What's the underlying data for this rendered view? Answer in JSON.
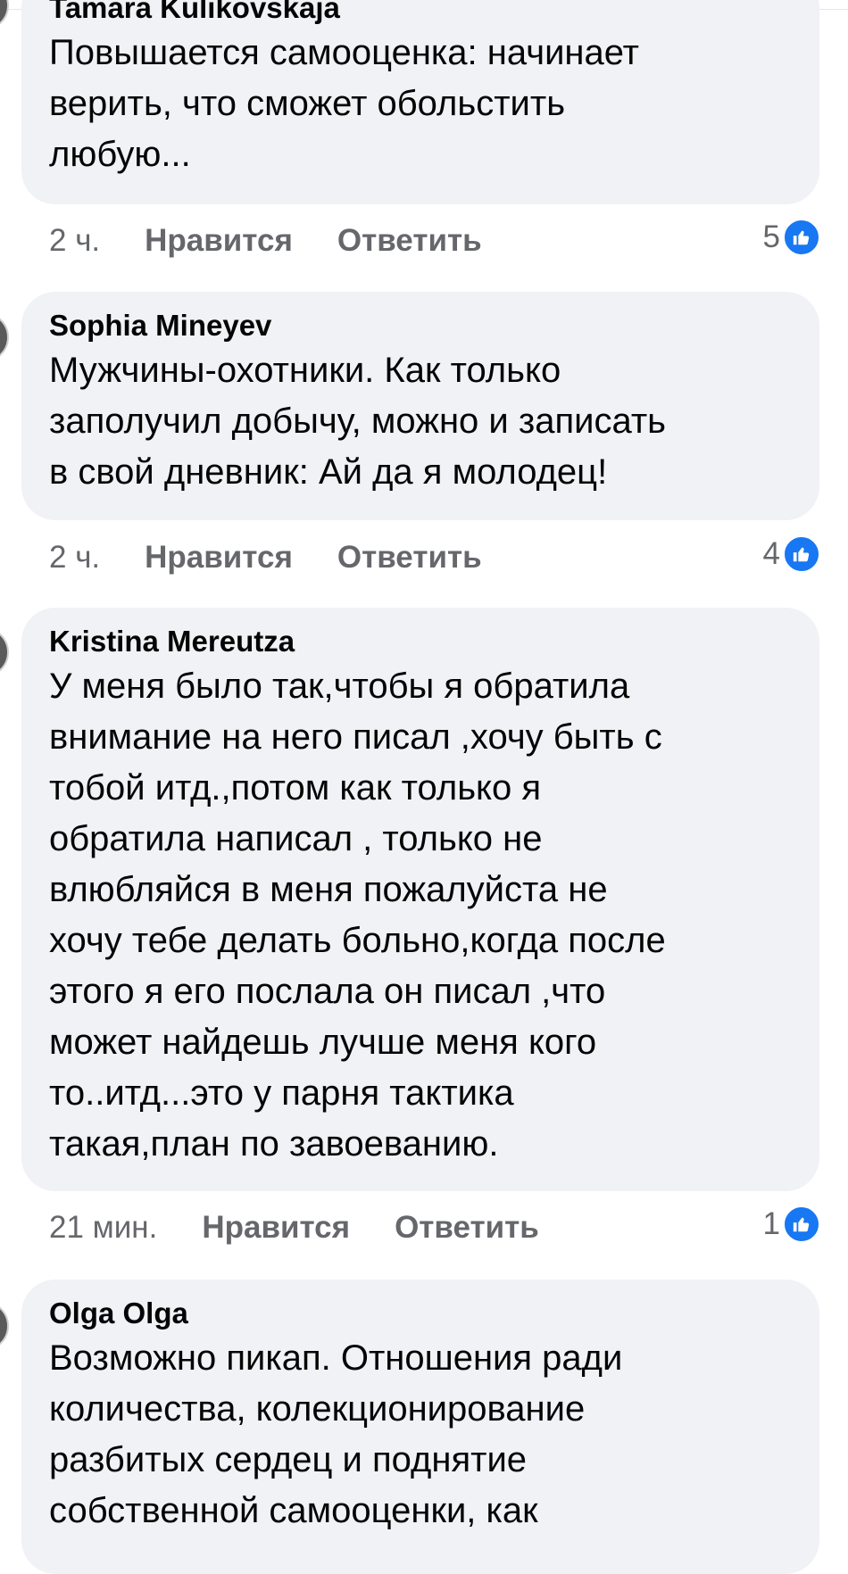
{
  "comments": [
    {
      "author": "Tamara Kulikovskaja",
      "lines": [
        "Повышается самооценка: начинает",
        "верить, что сможет обольстить",
        "любую..."
      ],
      "time": "2 ч.",
      "like_label": "Нравится",
      "reply_label": "Ответить",
      "reactions": "5"
    },
    {
      "author": "Sophia Mineyev",
      "lines": [
        "Мужчины-охотники. Как только",
        "заполучил добычу, можно и записать",
        "в свой дневник: Ай да я молодец!"
      ],
      "time": "2 ч.",
      "like_label": "Нравится",
      "reply_label": "Ответить",
      "reactions": "4"
    },
    {
      "author": "Kristina Mereutza",
      "lines": [
        "У меня было так,чтобы я обратила",
        "внимание на него писал ,хочу быть с",
        "тобой итд.,потом как только я",
        "обратила написал , только не",
        "влюбляйся в меня пожалуйста не",
        "хочу тебе делать больно,когда после",
        "этого я его послала он писал ,что",
        "может найдешь лучше меня кого",
        "то..итд...это у парня тактика",
        "такая,план по завоеванию."
      ],
      "time": "21 мин.",
      "like_label": "Нравится",
      "reply_label": "Ответить",
      "reactions": "1"
    },
    {
      "author": "Olga Olga",
      "lines": [
        "Возможно пикап. Отношения ради",
        "количества, колекционирование",
        "разбитых сердец и поднятие",
        "собственной самооценки, как"
      ]
    }
  ],
  "colors": {
    "bubble": "#f0f2f5",
    "meta": "#65676b",
    "like_blue": "#1877f2"
  },
  "icons": {
    "reaction": "like-thumb-icon"
  }
}
